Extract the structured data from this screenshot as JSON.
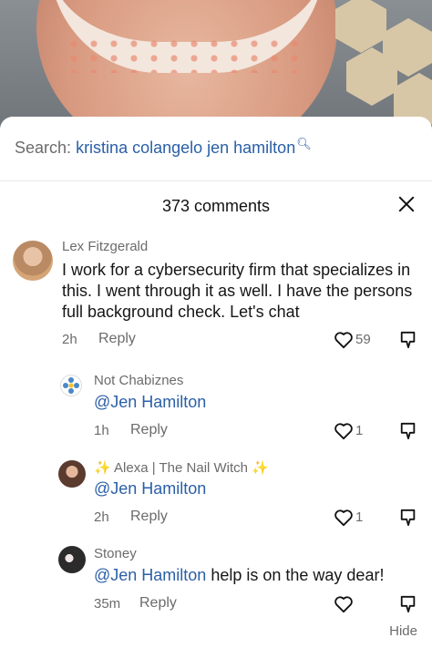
{
  "search": {
    "prefix": "Search:",
    "query": "kristina colangelo jen hamilton",
    "icon": "search-icon"
  },
  "header": {
    "title": "373 comments",
    "close_icon": "close-icon"
  },
  "comments": [
    {
      "user": "Lex Fitzgerald",
      "text": "I work for a cybersecurity firm that specializes in this. I went through it as well. I have the persons full background check. Let's chat",
      "time": "2h",
      "reply": "Reply",
      "likes": "59"
    },
    {
      "user": "Not Chabiznes",
      "mention": "@Jen Hamilton",
      "text": "",
      "time": "1h",
      "reply": "Reply",
      "likes": "1"
    },
    {
      "user": "✨ Alexa | The Nail Witch ✨",
      "mention": "@Jen Hamilton",
      "text": "",
      "time": "2h",
      "reply": "Reply",
      "likes": "1"
    },
    {
      "user": "Stoney",
      "mention": "@Jen Hamilton",
      "text": " help is on the way dear!",
      "time": "35m",
      "reply": "Reply",
      "likes": ""
    }
  ],
  "footer": {
    "hide": "Hide"
  },
  "colors": {
    "mention": "#2a5fa6",
    "muted": "#6b6b6b",
    "text": "#161616"
  }
}
